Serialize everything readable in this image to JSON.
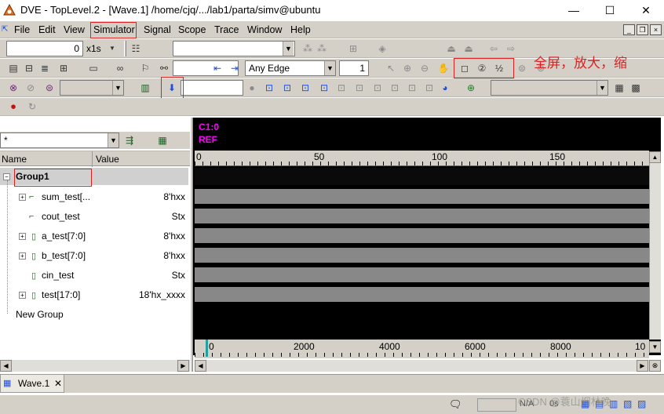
{
  "window": {
    "title": "DVE - TopLevel.2 - [Wave.1]  /home/cjq/.../lab1/parta/simv@ubuntu",
    "minimize": "—",
    "maximize": "☐",
    "close": "✕"
  },
  "menu": {
    "items": [
      "File",
      "Edit",
      "View",
      "Simulator",
      "Signal",
      "Scope",
      "Trace",
      "Window",
      "Help"
    ],
    "highlighted": "Simulator"
  },
  "toolbar1": {
    "time_value": "0",
    "time_unit": "x1s"
  },
  "toolbar2": {
    "edge_select": "Any Edge",
    "edge_count": "1"
  },
  "annotation_text": "全屏，放大，缩",
  "left_pane": {
    "filter_value": "*",
    "col_name": "Name",
    "col_value": "Value",
    "rows": [
      {
        "name": "Group1",
        "value": "",
        "level": 0,
        "expander": "-"
      },
      {
        "name": "sum_test[...",
        "value": "8'hxx",
        "level": 1,
        "expander": "+"
      },
      {
        "name": "cout_test",
        "value": "Stx",
        "level": 1,
        "expander": ""
      },
      {
        "name": "a_test[7:0]",
        "value": "8'hxx",
        "level": 1,
        "expander": "+"
      },
      {
        "name": "b_test[7:0]",
        "value": "8'hxx",
        "level": 1,
        "expander": "+"
      },
      {
        "name": "cin_test",
        "value": "Stx",
        "level": 1,
        "expander": ""
      },
      {
        "name": "test[17:0]",
        "value": "18'hx_xxxx",
        "level": 1,
        "expander": "+"
      },
      {
        "name": "New Group",
        "value": "",
        "level": 0,
        "expander": ""
      }
    ]
  },
  "wave_pane": {
    "cursor_label": "C1:0",
    "ref_label": "REF",
    "top_ruler": [
      "0",
      "50",
      "100",
      "150"
    ],
    "bottom_ruler": [
      "0",
      "2000",
      "4000",
      "6000",
      "8000",
      "10"
    ]
  },
  "tabs": [
    {
      "label": "Wave.1",
      "close": "✕"
    }
  ],
  "status": {
    "na": "N/A",
    "time": "0s"
  },
  "watermark": "CSDN @蓑山烟林晚"
}
